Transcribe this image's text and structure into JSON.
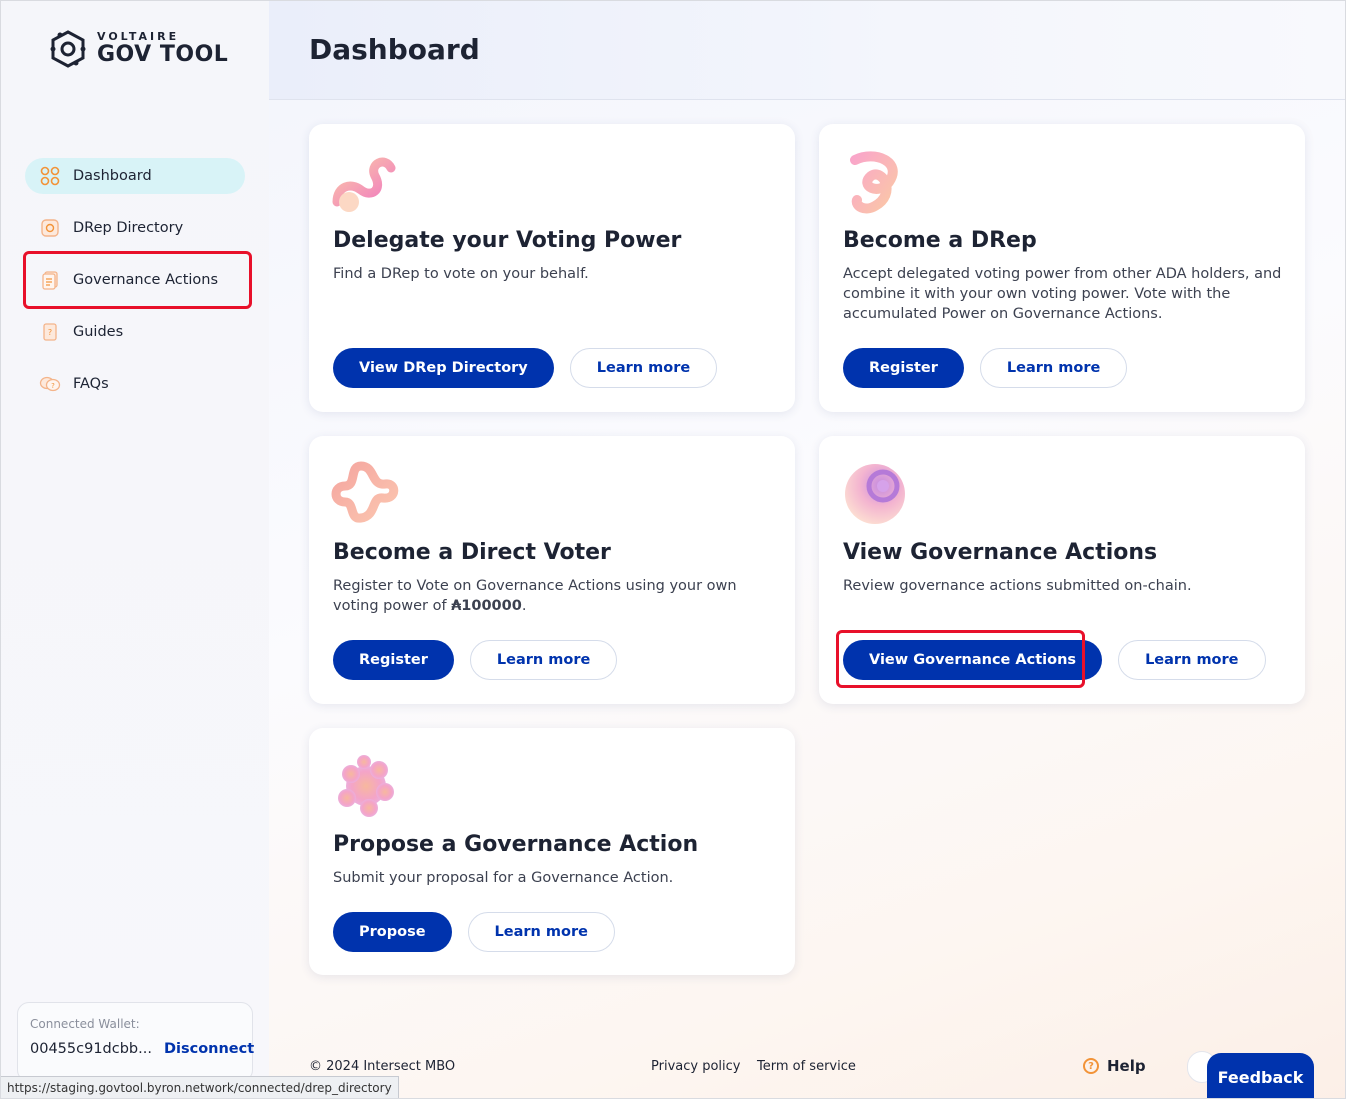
{
  "logo": {
    "top": "VOLTAIRE",
    "bottom": "GOV TOOL"
  },
  "sidebar": {
    "items": [
      {
        "label": "Dashboard",
        "icon": "dashboard-grid-icon",
        "active": true
      },
      {
        "label": "DRep Directory",
        "icon": "drep-directory-icon",
        "active": false
      },
      {
        "label": "Governance Actions",
        "icon": "governance-actions-icon",
        "active": false
      },
      {
        "label": "Guides",
        "icon": "guides-icon",
        "active": false
      },
      {
        "label": "FAQs",
        "icon": "faqs-icon",
        "active": false
      }
    ]
  },
  "wallet": {
    "label": "Connected Wallet:",
    "address": "00455c91dcbb...",
    "disconnect": "Disconnect"
  },
  "status_url": "https://staging.govtool.byron.network/connected/drep_directory",
  "header": {
    "title": "Dashboard"
  },
  "cards": [
    {
      "title": "Delegate your Voting Power",
      "description": "Find a DRep to vote on your behalf.",
      "primary": "View DRep Directory",
      "secondary": "Learn more"
    },
    {
      "title": "Become a DRep",
      "description": "Accept delegated voting power from other ADA holders, and combine it with your own voting power. Vote with the accumulated Power on Governance Actions.",
      "primary": "Register",
      "secondary": "Learn more"
    },
    {
      "title": "Become a Direct Voter",
      "description_prefix": "Register to Vote on Governance Actions using your own voting power of ",
      "description_amount": "₳100000",
      "description_suffix": ".",
      "primary": "Register",
      "secondary": "Learn more"
    },
    {
      "title": "View Governance Actions",
      "description": "Review governance actions submitted on-chain.",
      "primary": "View Governance Actions",
      "secondary": "Learn more"
    },
    {
      "title": "Propose a Governance Action",
      "description": "Submit your proposal for a Governance Action.",
      "primary": "Propose",
      "secondary": "Learn more"
    }
  ],
  "footer": {
    "copyright": "© 2024 Intersect MBO",
    "privacy": "Privacy policy",
    "terms": "Term of service",
    "help": "Help",
    "feedback": "Feedback"
  },
  "colors": {
    "brand_blue": "#0033ad",
    "highlight_red": "#e8102a",
    "active_nav": "#d8f3f7",
    "accent_orange": "#f29338"
  }
}
